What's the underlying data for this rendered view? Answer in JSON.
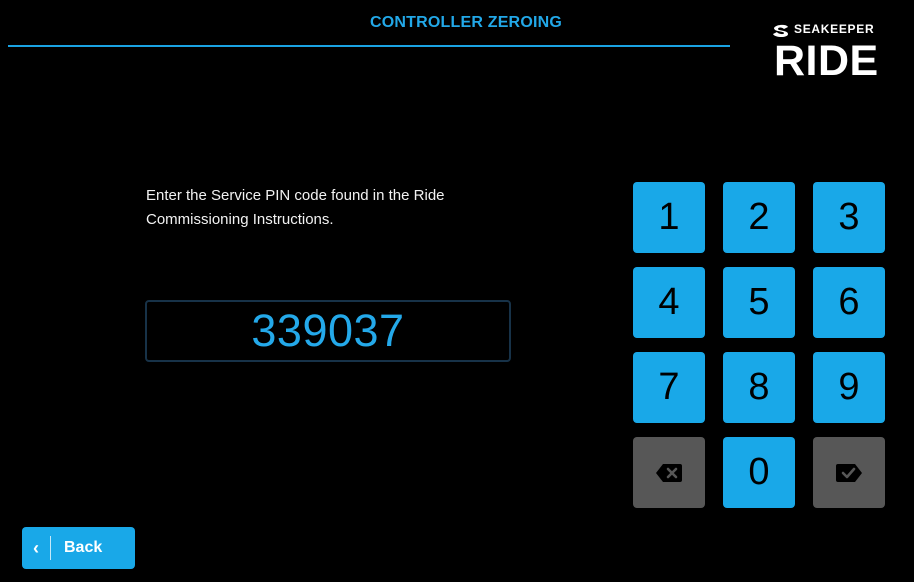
{
  "header": {
    "title": "CONTROLLER ZEROING"
  },
  "brand": {
    "name": "SEAKEEPER",
    "logo": "RIDE"
  },
  "instructions": {
    "text": "Enter the Service PIN code found in the Ride Commissioning Instructions."
  },
  "pin": {
    "value": "339037"
  },
  "keypad": {
    "keys": [
      "1",
      "2",
      "3",
      "4",
      "5",
      "6",
      "7",
      "8",
      "9",
      "0"
    ],
    "backspace_icon": "backspace-icon",
    "confirm_icon": "confirm-icon"
  },
  "footer": {
    "back_label": "Back",
    "back_icon": "chevron-left-icon"
  },
  "colors": {
    "accent": "#19a8e8",
    "accent_text": "#24a9ea",
    "disabled": "#575757",
    "background": "#000000"
  }
}
